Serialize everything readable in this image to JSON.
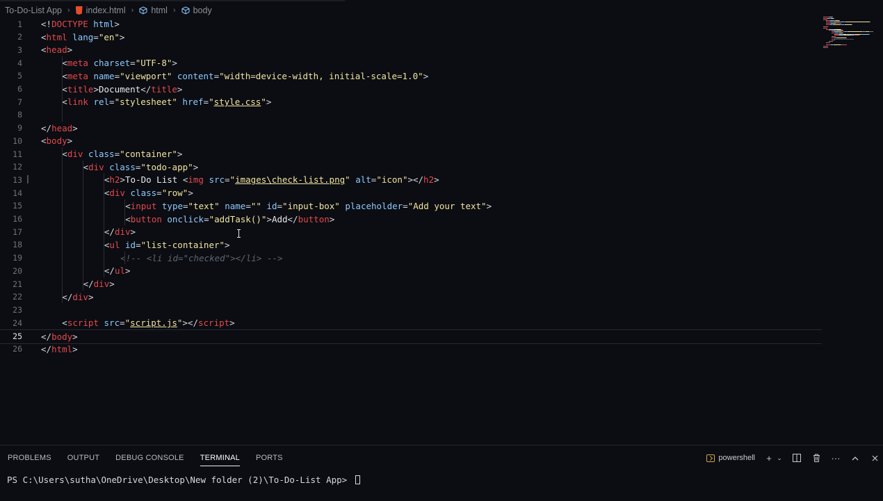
{
  "breadcrumb": {
    "folder": "To-Do-List App",
    "file": "index.html",
    "html": "html",
    "body": "body"
  },
  "editor": {
    "current_line": 25,
    "lines": [
      {
        "n": "1",
        "indent": 0,
        "tokens": [
          [
            "p",
            "<!"
          ],
          [
            "t",
            "DOCTYPE"
          ],
          [
            "p",
            " "
          ],
          [
            "a",
            "html"
          ],
          [
            "p",
            ">"
          ]
        ]
      },
      {
        "n": "2",
        "indent": 0,
        "tokens": [
          [
            "p",
            "<"
          ],
          [
            "t",
            "html"
          ],
          [
            "p",
            " "
          ],
          [
            "a",
            "lang"
          ],
          [
            "p",
            "="
          ],
          [
            "s",
            "\"en\""
          ],
          [
            "p",
            ">"
          ]
        ]
      },
      {
        "n": "3",
        "indent": 0,
        "tokens": [
          [
            "p",
            "<"
          ],
          [
            "t",
            "head"
          ],
          [
            "p",
            ">"
          ]
        ]
      },
      {
        "n": "4",
        "indent": 1,
        "tokens": [
          [
            "p",
            "<"
          ],
          [
            "t",
            "meta"
          ],
          [
            "p",
            " "
          ],
          [
            "a",
            "charset"
          ],
          [
            "p",
            "="
          ],
          [
            "s",
            "\"UTF-8\""
          ],
          [
            "p",
            ">"
          ]
        ]
      },
      {
        "n": "5",
        "indent": 1,
        "tokens": [
          [
            "p",
            "<"
          ],
          [
            "t",
            "meta"
          ],
          [
            "p",
            " "
          ],
          [
            "a",
            "name"
          ],
          [
            "p",
            "="
          ],
          [
            "s",
            "\"viewport\""
          ],
          [
            "p",
            " "
          ],
          [
            "a",
            "content"
          ],
          [
            "p",
            "="
          ],
          [
            "s",
            "\"width=device-width, initial-scale=1.0\""
          ],
          [
            "p",
            ">"
          ]
        ]
      },
      {
        "n": "6",
        "indent": 1,
        "tokens": [
          [
            "p",
            "<"
          ],
          [
            "t",
            "title"
          ],
          [
            "p",
            ">"
          ],
          [
            "x",
            "Document"
          ],
          [
            "p",
            "</"
          ],
          [
            "t",
            "title"
          ],
          [
            "p",
            ">"
          ]
        ]
      },
      {
        "n": "7",
        "indent": 1,
        "tokens": [
          [
            "p",
            "<"
          ],
          [
            "t",
            "link"
          ],
          [
            "p",
            " "
          ],
          [
            "a",
            "rel"
          ],
          [
            "p",
            "="
          ],
          [
            "s",
            "\"stylesheet\""
          ],
          [
            "p",
            " "
          ],
          [
            "a",
            "href"
          ],
          [
            "p",
            "="
          ],
          [
            "s",
            "\""
          ],
          [
            "u",
            "style.css"
          ],
          [
            "s",
            "\""
          ],
          [
            "p",
            ">"
          ]
        ]
      },
      {
        "n": "8",
        "indent": 0,
        "tokens": []
      },
      {
        "n": "9",
        "indent": 0,
        "tokens": [
          [
            "p",
            "</"
          ],
          [
            "t",
            "head"
          ],
          [
            "p",
            ">"
          ]
        ]
      },
      {
        "n": "10",
        "indent": 0,
        "tokens": [
          [
            "p",
            "<"
          ],
          [
            "t",
            "body"
          ],
          [
            "p",
            ">"
          ]
        ]
      },
      {
        "n": "11",
        "indent": 1,
        "tokens": [
          [
            "p",
            "<"
          ],
          [
            "t",
            "div"
          ],
          [
            "p",
            " "
          ],
          [
            "a",
            "class"
          ],
          [
            "p",
            "="
          ],
          [
            "s",
            "\"container\""
          ],
          [
            "p",
            ">"
          ]
        ]
      },
      {
        "n": "12",
        "indent": 2,
        "tokens": [
          [
            "p",
            "<"
          ],
          [
            "t",
            "div"
          ],
          [
            "p",
            " "
          ],
          [
            "a",
            "class"
          ],
          [
            "p",
            "="
          ],
          [
            "s",
            "\"todo-app\""
          ],
          [
            "p",
            ">"
          ]
        ]
      },
      {
        "n": "13",
        "indent": 3,
        "tokens": [
          [
            "p",
            "<"
          ],
          [
            "t",
            "h2"
          ],
          [
            "p",
            ">"
          ],
          [
            "x",
            "To-Do List "
          ],
          [
            "p",
            "<"
          ],
          [
            "t",
            "img"
          ],
          [
            "p",
            " "
          ],
          [
            "a",
            "src"
          ],
          [
            "p",
            "="
          ],
          [
            "s",
            "\""
          ],
          [
            "u",
            "images\\check-list.png"
          ],
          [
            "s",
            "\""
          ],
          [
            "p",
            " "
          ],
          [
            "a",
            "alt"
          ],
          [
            "p",
            "="
          ],
          [
            "s",
            "\"icon\""
          ],
          [
            "p",
            "></"
          ],
          [
            "t",
            "h2"
          ],
          [
            "p",
            ">"
          ]
        ]
      },
      {
        "n": "14",
        "indent": 3,
        "tokens": [
          [
            "p",
            "<"
          ],
          [
            "t",
            "div"
          ],
          [
            "p",
            " "
          ],
          [
            "a",
            "class"
          ],
          [
            "p",
            "="
          ],
          [
            "s",
            "\"row\""
          ],
          [
            "p",
            ">"
          ]
        ]
      },
      {
        "n": "15",
        "indent": 4,
        "tokens": [
          [
            "p",
            "<"
          ],
          [
            "t",
            "input"
          ],
          [
            "p",
            " "
          ],
          [
            "a",
            "type"
          ],
          [
            "p",
            "="
          ],
          [
            "s",
            "\"text\""
          ],
          [
            "p",
            " "
          ],
          [
            "a",
            "name"
          ],
          [
            "p",
            "="
          ],
          [
            "s",
            "\"\""
          ],
          [
            "p",
            " "
          ],
          [
            "a",
            "id"
          ],
          [
            "p",
            "="
          ],
          [
            "s",
            "\"input-box\""
          ],
          [
            "p",
            " "
          ],
          [
            "a",
            "placeholder"
          ],
          [
            "p",
            "="
          ],
          [
            "s",
            "\"Add your text\""
          ],
          [
            "p",
            ">"
          ]
        ]
      },
      {
        "n": "16",
        "indent": 4,
        "tokens": [
          [
            "p",
            "<"
          ],
          [
            "t",
            "button"
          ],
          [
            "p",
            " "
          ],
          [
            "a",
            "onclick"
          ],
          [
            "p",
            "="
          ],
          [
            "s",
            "\"addTask()\""
          ],
          [
            "p",
            ">"
          ],
          [
            "x",
            "Add"
          ],
          [
            "p",
            "</"
          ],
          [
            "t",
            "button"
          ],
          [
            "p",
            ">"
          ]
        ]
      },
      {
        "n": "17",
        "indent": 3,
        "tokens": [
          [
            "p",
            "</"
          ],
          [
            "t",
            "div"
          ],
          [
            "p",
            ">"
          ]
        ]
      },
      {
        "n": "18",
        "indent": 3,
        "tokens": [
          [
            "p",
            "<"
          ],
          [
            "t",
            "ul"
          ],
          [
            "p",
            " "
          ],
          [
            "a",
            "id"
          ],
          [
            "p",
            "="
          ],
          [
            "s",
            "\"list-container\""
          ],
          [
            "p",
            ">"
          ]
        ]
      },
      {
        "n": "19",
        "indent": 4,
        "tokens": [
          [
            "c",
            "<!-- <li id=\"checked\"></li> -->"
          ]
        ],
        "shift": -1
      },
      {
        "n": "20",
        "indent": 3,
        "tokens": [
          [
            "p",
            "</"
          ],
          [
            "t",
            "ul"
          ],
          [
            "p",
            ">"
          ]
        ]
      },
      {
        "n": "21",
        "indent": 2,
        "tokens": [
          [
            "p",
            "</"
          ],
          [
            "t",
            "div"
          ],
          [
            "p",
            ">"
          ]
        ]
      },
      {
        "n": "22",
        "indent": 1,
        "tokens": [
          [
            "p",
            "</"
          ],
          [
            "t",
            "div"
          ],
          [
            "p",
            ">"
          ]
        ]
      },
      {
        "n": "23",
        "indent": 0,
        "tokens": []
      },
      {
        "n": "24",
        "indent": 1,
        "tokens": [
          [
            "p",
            "<"
          ],
          [
            "t",
            "script"
          ],
          [
            "p",
            " "
          ],
          [
            "a",
            "src"
          ],
          [
            "p",
            "="
          ],
          [
            "s",
            "\""
          ],
          [
            "u",
            "script.js"
          ],
          [
            "s",
            "\""
          ],
          [
            "p",
            "></"
          ],
          [
            "t",
            "script"
          ],
          [
            "p",
            ">"
          ]
        ]
      },
      {
        "n": "25",
        "indent": 0,
        "tokens": [
          [
            "p",
            "</"
          ],
          [
            "t",
            "body"
          ],
          [
            "p",
            ">"
          ]
        ]
      },
      {
        "n": "26",
        "indent": 0,
        "tokens": [
          [
            "p",
            "</"
          ],
          [
            "t",
            "html"
          ],
          [
            "p",
            ">"
          ]
        ]
      }
    ]
  },
  "panel": {
    "tabs": [
      "PROBLEMS",
      "OUTPUT",
      "DEBUG CONSOLE",
      "TERMINAL",
      "PORTS"
    ],
    "active_tab": "TERMINAL",
    "shell_label": "powershell",
    "terminal_prompt": "PS C:\\Users\\sutha\\OneDrive\\Desktop\\New folder (2)\\To-Do-List App> "
  },
  "colors": {
    "tag": "#e5484d",
    "attribute": "#8ec9ff",
    "string": "#f2e4a0",
    "comment": "#5e6470",
    "background": "#0b0d12"
  }
}
